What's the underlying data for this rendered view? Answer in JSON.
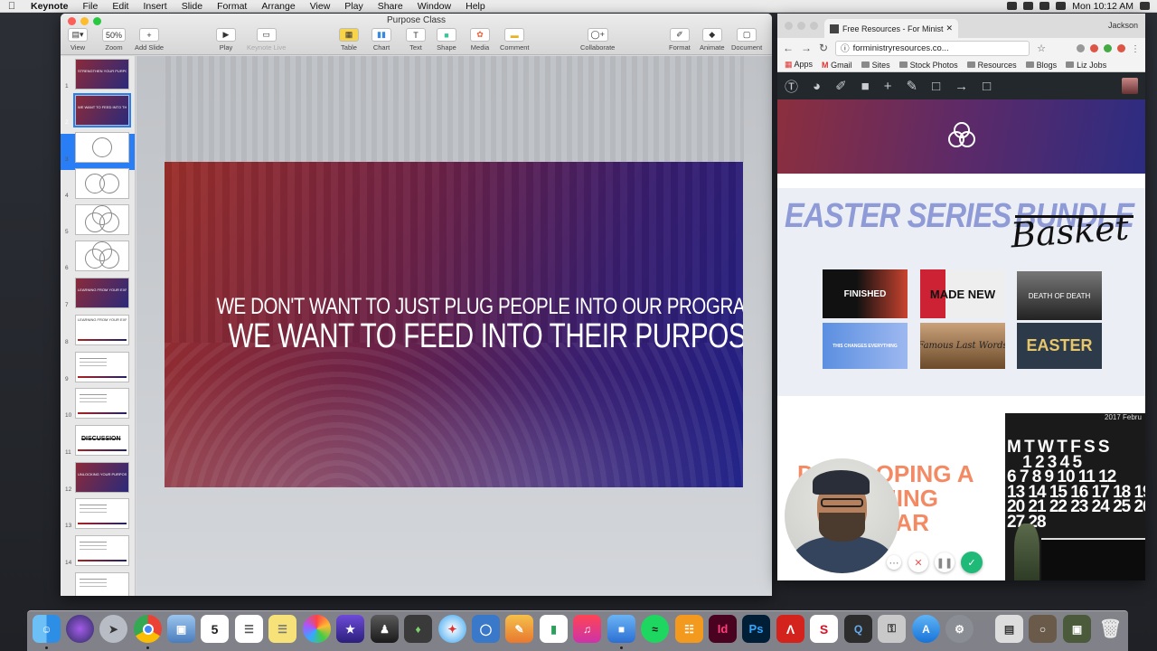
{
  "menubar": {
    "app": "Keynote",
    "items": [
      "File",
      "Edit",
      "Insert",
      "Slide",
      "Format",
      "Arrange",
      "View",
      "Play",
      "Share",
      "Window",
      "Help"
    ],
    "clock": "Mon 10:12 AM"
  },
  "keynote": {
    "title": "Purpose Class",
    "toolbar": {
      "view": "View",
      "zoom_value": "50%",
      "zoom": "Zoom",
      "add_slide": "Add Slide",
      "play": "Play",
      "keynote_live": "Keynote Live",
      "table": "Table",
      "chart": "Chart",
      "text": "Text",
      "shape": "Shape",
      "media": "Media",
      "comment": "Comment",
      "collaborate": "Collaborate",
      "format": "Format",
      "animate": "Animate",
      "document": "Document"
    },
    "thumbnails": [
      "1",
      "2",
      "3",
      "4",
      "5",
      "6",
      "7",
      "8",
      "9",
      "10",
      "11",
      "12",
      "13",
      "14"
    ],
    "thumb_texts": {
      "t1": "STRENGTHEN YOUR PURPOSE",
      "t2": "WE WANT TO FEED INTO THEIR PURPOSE",
      "t7": "LEARNING FROM YOUR EXPERIENCE",
      "t8": "LEARNING FROM YOUR EXPERIENCE",
      "t11": "DISCUSSION",
      "t12": "UNLOCKING YOUR PURPOSE"
    },
    "slide": {
      "line1": "WE DON'T WANT TO JUST PLUG PEOPLE INTO OUR PROGRAMS.",
      "line2": "WE WANT TO FEED INTO THEIR PURPOSE."
    }
  },
  "chrome": {
    "tab_title": "Free Resources - For Minist",
    "user": "Jackson",
    "url": "forministryresources.co...",
    "bookmarks": {
      "apps": "Apps",
      "gmail": "Gmail",
      "sites": "Sites",
      "stock": "Stock Photos",
      "resources": "Resources",
      "blogs": "Blogs",
      "liz": "Liz Jobs"
    },
    "ad": {
      "title": "EASTER SERIES",
      "crossed": "BUNDLE",
      "script": "Basket",
      "cards": [
        "FINISHED",
        "MADE NEW",
        "DEATH OF DEATH",
        "THIS CHANGES EVERYTHING",
        "Famous Last Words",
        "EASTER"
      ]
    },
    "calendar_heading": "DEVELOPING A PREACHING CALENDAR",
    "calendar_year": "2017   Febru",
    "calendar_grid": "M T W T F S S\n    1 2 3 4 5\n6 7 8 9 10 11 12\n13 14 15 16 17 18 19\n20 21 22 23 24 25 26\n27 28"
  },
  "colors": {
    "slide_start": "#9c2f2a",
    "slide_end": "#1d1f86",
    "accent_blue": "#2a7ef5",
    "wp_bar": "#23282d"
  }
}
